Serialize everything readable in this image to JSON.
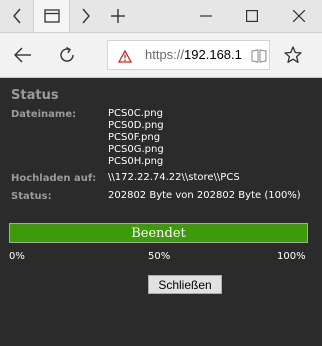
{
  "browser": {
    "url_scheme": "https://",
    "url_host": "192.168.1"
  },
  "page": {
    "heading": "Status",
    "filename_label": "Dateiname:",
    "files": [
      "PCS0C.png",
      "PCS0D.png",
      "PCS0F.png",
      "PCS0G.png",
      "PCS0H.png"
    ],
    "upload_label": "Hochladen auf:",
    "upload_path": "\\\\172.22.74.22\\\\store\\\\PCS",
    "status_label": "Status:",
    "status_value": "202802 Byte von 202802 Byte (100%)",
    "progress": {
      "label": "Beendet",
      "percent": 100,
      "color": "#3d9a0a",
      "ticks": [
        "0%",
        "50%",
        "100%"
      ]
    },
    "close_button": "Schließen"
  }
}
